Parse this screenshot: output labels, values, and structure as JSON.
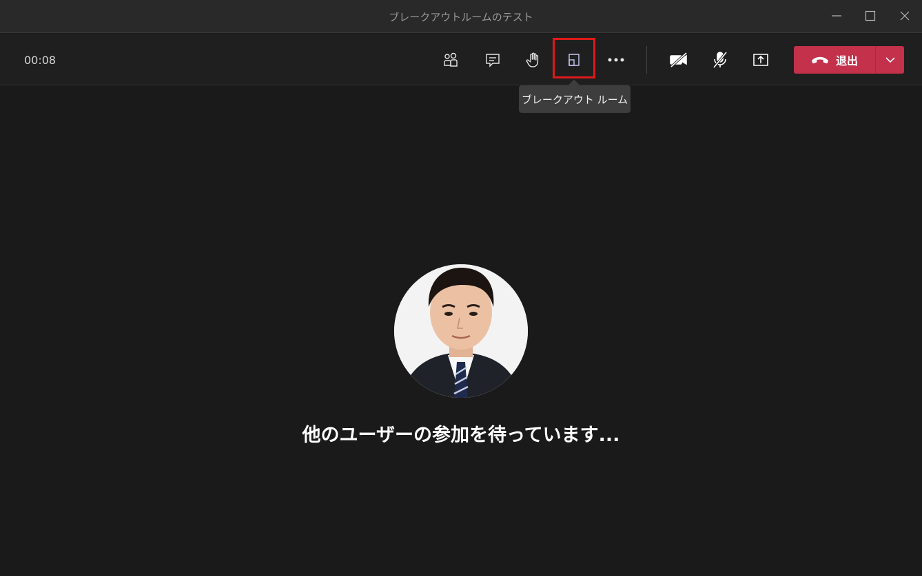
{
  "window": {
    "title": "ブレークアウトルームのテスト"
  },
  "toolbar": {
    "timer": "00:08",
    "buttons": [
      {
        "name": "participants-icon"
      },
      {
        "name": "chat-icon"
      },
      {
        "name": "raise-hand-icon"
      },
      {
        "name": "breakout-rooms-icon"
      },
      {
        "name": "more-actions-icon"
      },
      {
        "name": "camera-off-icon"
      },
      {
        "name": "mic-off-icon"
      },
      {
        "name": "share-screen-icon"
      }
    ],
    "leave_label": "退出",
    "tooltip": "ブレークアウト ルーム"
  },
  "main": {
    "waiting_text": "他のユーザーの参加を待っています..."
  },
  "colors": {
    "leave": "#c4314b",
    "highlight": "#e0191b",
    "background": "#1b1a1b"
  }
}
